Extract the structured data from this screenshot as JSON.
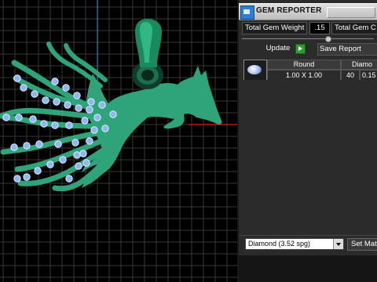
{
  "panel": {
    "title": "GEM REPORTER",
    "total_gem_weight_label": "Total Gem Weight",
    "total_gem_weight_value": ".15",
    "total_gem_count_label": "Total Gem C",
    "update_label": "Update",
    "save_report_label": "Save Report",
    "table": {
      "headers": [
        "Round",
        "Diamo"
      ],
      "row": {
        "size": "1.00 X 1.00",
        "count": "40",
        "weight": "0.15"
      }
    },
    "material_select": "Diamond   (3.52 spg)",
    "set_material_label": "Set Mat"
  },
  "colors": {
    "model": "#2fa37a",
    "gem": "#8fb6ee",
    "grid": "#3a3a3a",
    "axis_x": "#d11f1f",
    "axis_y": "#2fa3c9",
    "panel_bg": "#2b2b2b"
  },
  "icons": {
    "app": "gem-reporter-logo-icon",
    "update": "play-arrow-icon",
    "thumbnail": "round-diamond-icon",
    "dropdown": "chevron-down-icon"
  }
}
